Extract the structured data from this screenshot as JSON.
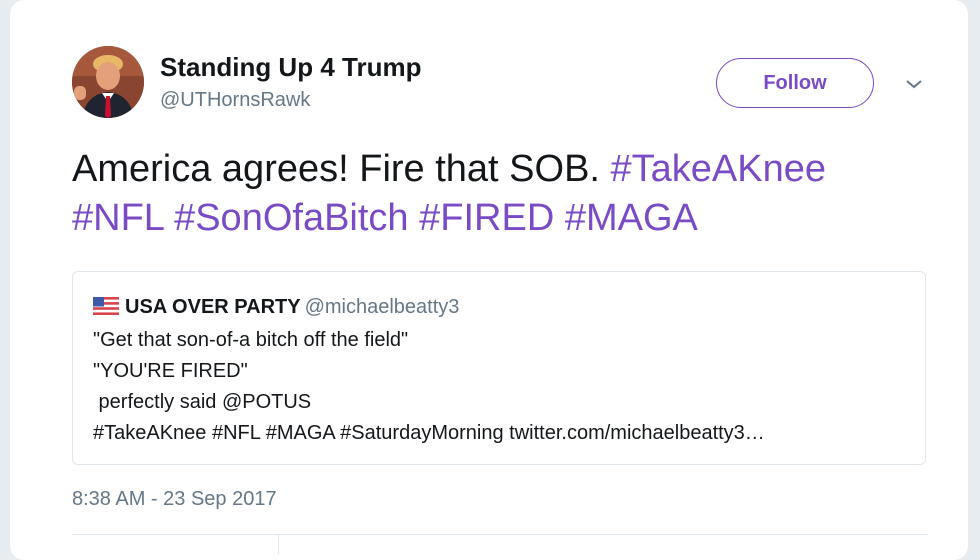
{
  "tweet": {
    "author": {
      "display_name": "Standing Up 4 Trump",
      "handle": "@UTHornsRawk",
      "avatar": "profile-photo"
    },
    "follow_label": "Follow",
    "menu_icon": "chevron-down-icon",
    "text_plain": "America agrees!  Fire that SOB. ",
    "hashtags": [
      "#TakeAKnee",
      "#NFL",
      "#SonOfaBitch",
      "#FIRED",
      "#MAGA"
    ],
    "timestamp": "8:38 AM - 23 Sep 2017"
  },
  "quote": {
    "flag_icon": "us-flag-icon",
    "name": "USA OVER PARTY",
    "handle": "@michaelbeatty3",
    "lines": [
      "\"Get that son-of-a bitch off the field\"",
      "\"YOU'RE FIRED\"",
      " perfectly said @POTUS",
      "#TakeAKnee #NFL #MAGA #SaturdayMorning twitter.com/michaelbeatty3…"
    ]
  },
  "colors": {
    "accent": "#794bc4",
    "text": "#14171a",
    "secondary": "#657786",
    "border": "#e1e8ed"
  }
}
